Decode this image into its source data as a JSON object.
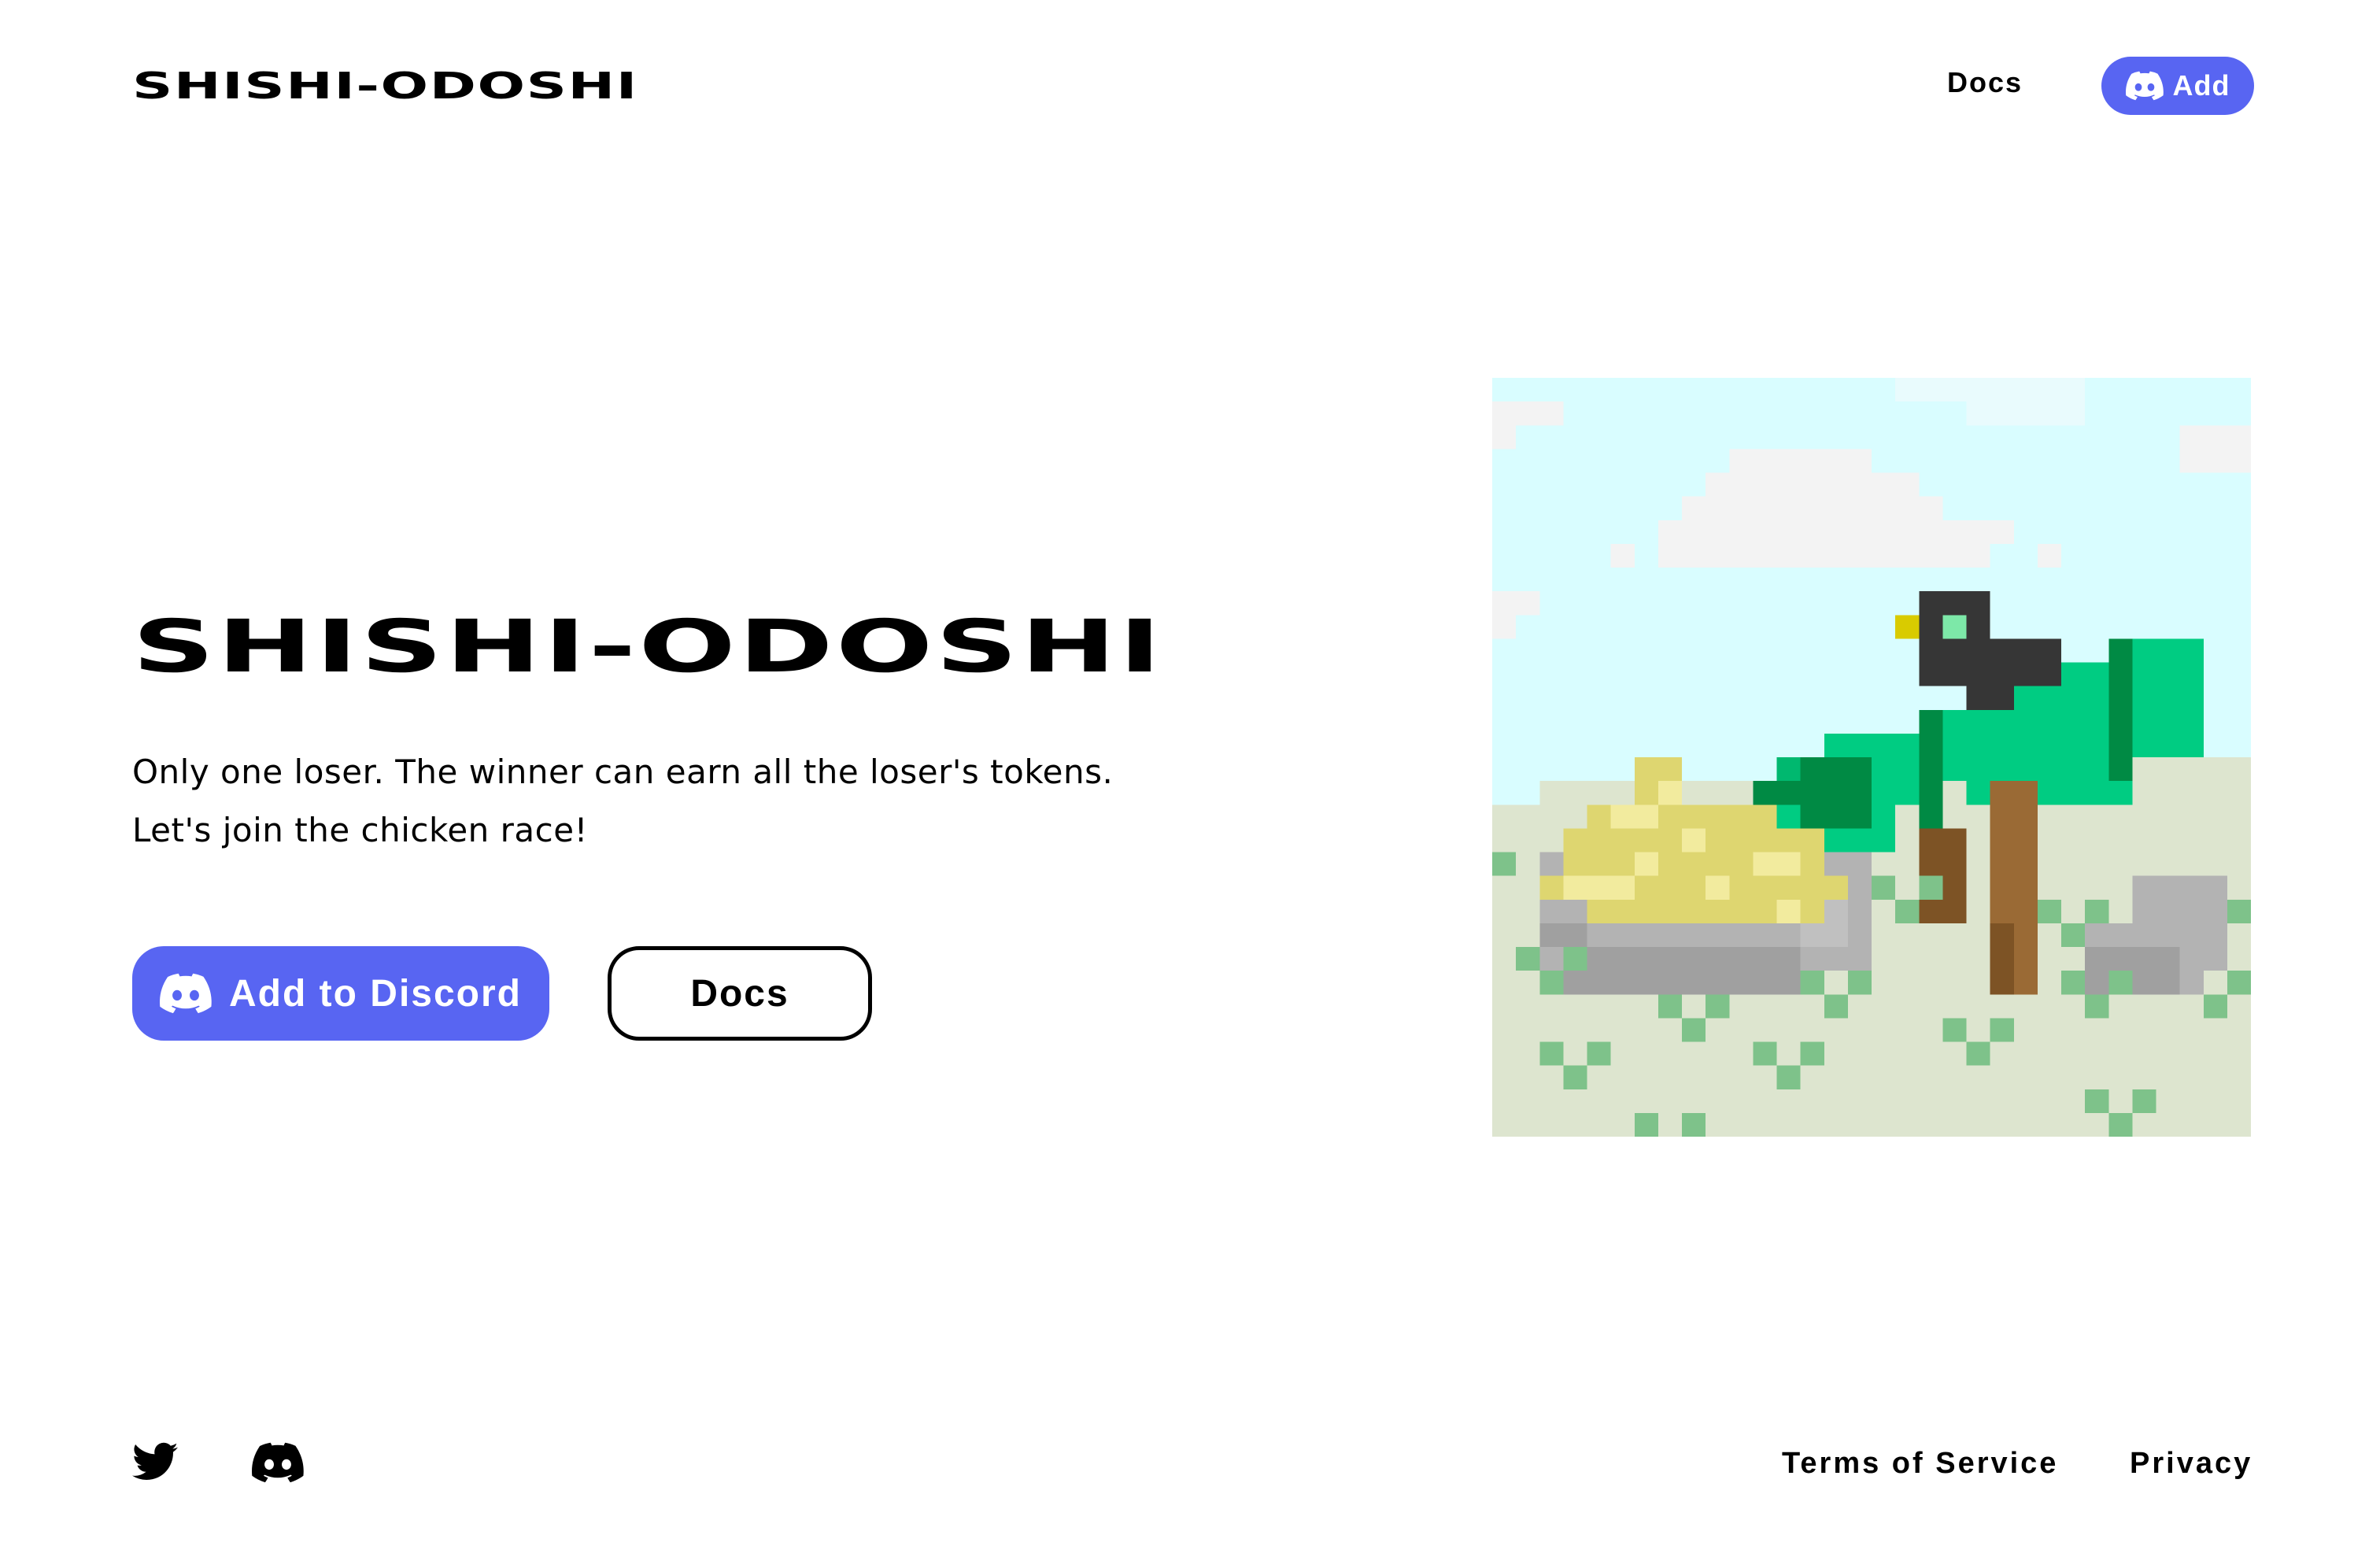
{
  "header": {
    "logo": "SHISHI-ODOSHI",
    "nav_docs": "Docs",
    "nav_add": "Add",
    "nav_add_icon": "discord-icon"
  },
  "hero": {
    "title": "SHISHI-ODOSHI",
    "description_line1": "Only one loser. The winner can earn all the loser's tokens.",
    "description_line2": "Let's join the chicken race!",
    "discord_button": "Add to Discord",
    "discord_button_icon": "discord-icon",
    "docs_button": "Docs",
    "artwork": "pixel-art-bird-on-tree-illustration"
  },
  "footer": {
    "twitter_icon": "twitter-icon",
    "discord_icon": "discord-icon",
    "terms": "Terms of Service",
    "privacy": "Privacy"
  },
  "colors": {
    "brand": "#5865f2",
    "text": "#000000",
    "background": "#ffffff",
    "sky": "#d9fdff",
    "ground": "#dde5cf",
    "tree": "#00cc82",
    "tree_dark": "#008a44",
    "trunk": "#9a6a35",
    "rock": "#b3b3b3",
    "straw": "#ded670",
    "bird": "#363636"
  }
}
